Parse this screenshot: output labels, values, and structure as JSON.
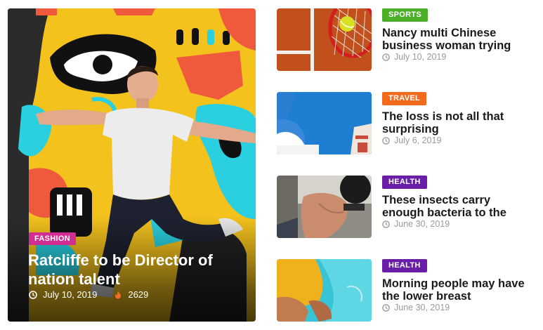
{
  "featured": {
    "category": "FASHION",
    "category_color": "#d12d92",
    "title": "Ratcliffe to be Director of nation talent",
    "date": "July 10, 2019",
    "views": "2629",
    "date_icon": "clock-icon",
    "views_icon": "fire-icon"
  },
  "posts": [
    {
      "category": "SPORTS",
      "category_color": "#4caf28",
      "title": "Nancy multi Chinese business woman trying",
      "date": "July 10, 2019"
    },
    {
      "category": "TRAVEL",
      "category_color": "#f26b1d",
      "title": "The loss is not all that surprising",
      "date": "July 6, 2019"
    },
    {
      "category": "HEALTH",
      "category_color": "#6a1ea8",
      "title": "These insects carry enough bacteria to the",
      "date": "June 30, 2019"
    },
    {
      "category": "HEALTH",
      "category_color": "#6a1ea8",
      "title": "Morning people may have the lower breast",
      "date": "June 30, 2019"
    }
  ]
}
